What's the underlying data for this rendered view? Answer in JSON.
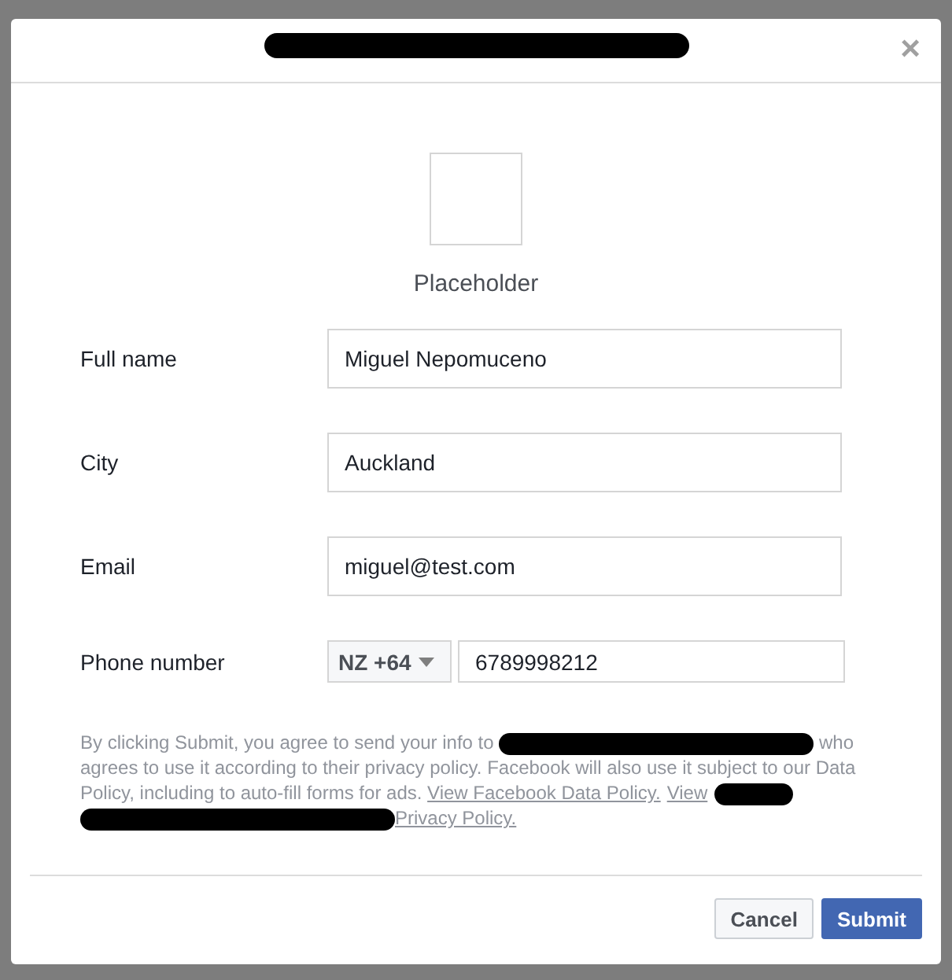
{
  "dialog": {
    "title_redacted": true,
    "close_label": "×"
  },
  "image": {
    "caption": "Placeholder"
  },
  "fields": [
    {
      "label": "Full name",
      "value": "Miguel Nepomuceno",
      "kind": "text"
    },
    {
      "label": "City",
      "value": "Auckland",
      "kind": "text"
    },
    {
      "label": "Email",
      "value": "miguel@test.com",
      "kind": "text"
    },
    {
      "label": "Phone number",
      "kind": "phone",
      "country": "NZ +64",
      "value": "6789998212"
    }
  ],
  "disclaimer": [
    {
      "kind": "text",
      "text": "By clicking Submit, you agree to send your info to "
    },
    {
      "kind": "redacted_long"
    },
    {
      "kind": "text",
      "text": " who agrees to use it according to their privacy policy. Facebook will also use it subject to our Data Policy, including to auto-fill forms for ads. "
    },
    {
      "kind": "link",
      "text": "View Facebook Data Policy."
    },
    {
      "kind": "link",
      "text": "View"
    },
    {
      "kind": "redacted_short"
    },
    {
      "kind": "redacted_long"
    },
    {
      "kind": "link",
      "text": "Privacy Policy."
    }
  ],
  "buttons": [
    {
      "label": "Cancel",
      "kind": "secondary"
    },
    {
      "label": "Submit",
      "kind": "primary"
    }
  ]
}
